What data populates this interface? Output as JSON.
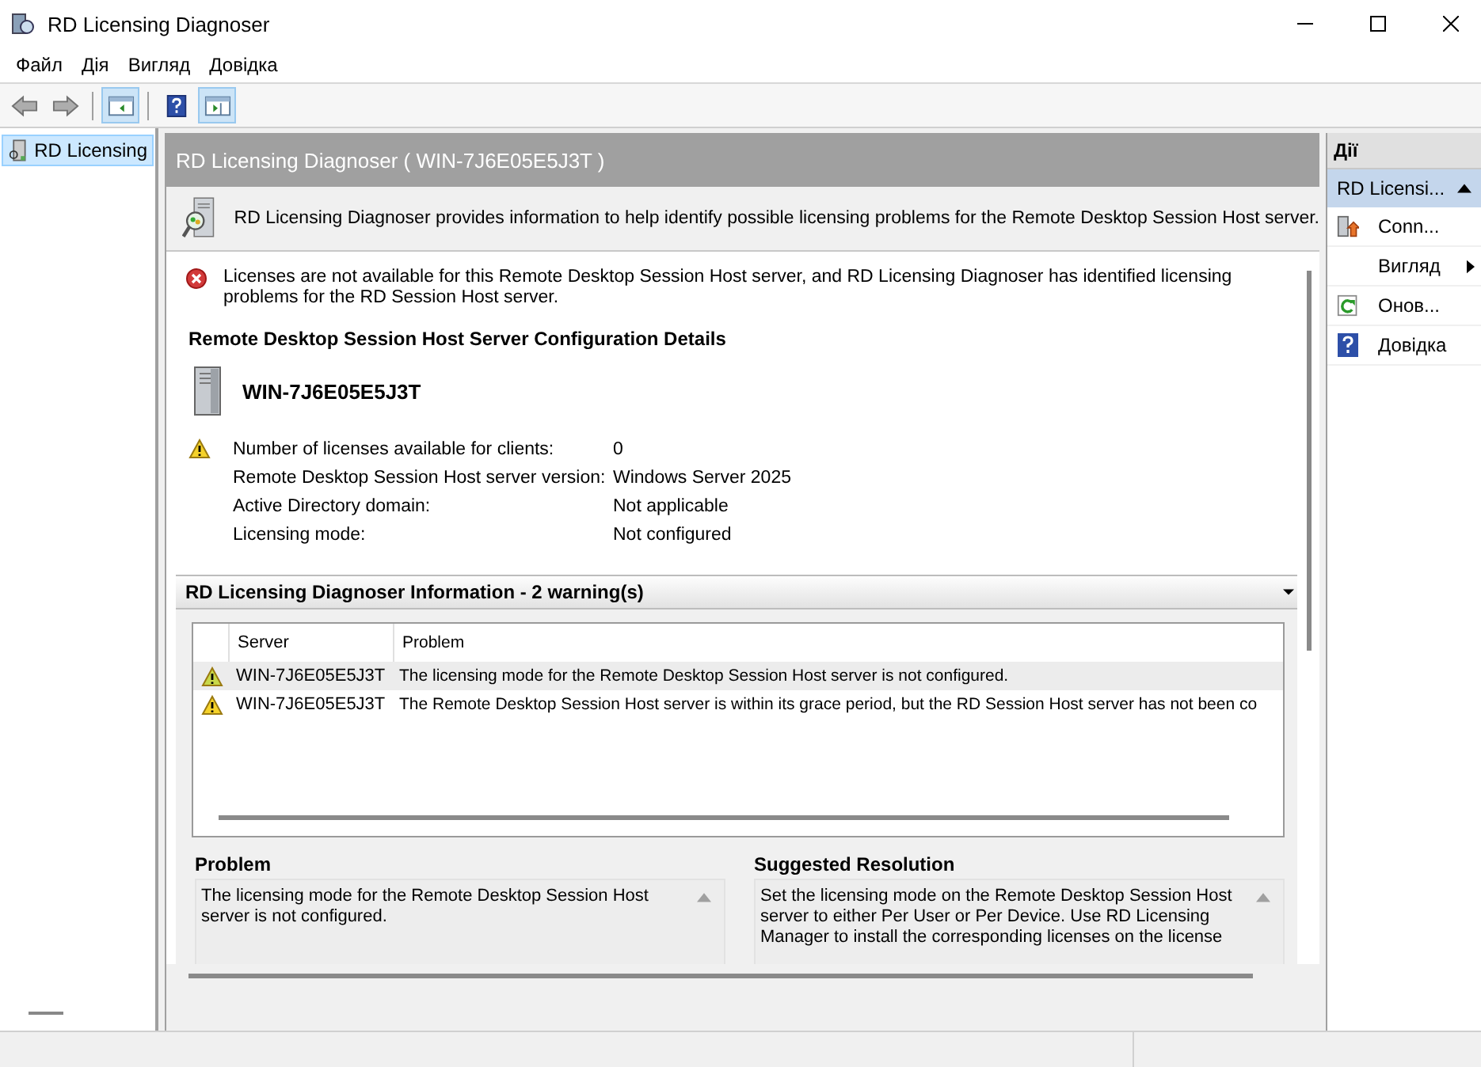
{
  "window": {
    "title": "RD Licensing Diagnoser"
  },
  "menu": [
    "Файл",
    "Дія",
    "Вигляд",
    "Довідка"
  ],
  "toolbar": [
    {
      "kind": "back",
      "disabled": true,
      "pressed": false
    },
    {
      "kind": "forward",
      "disabled": true,
      "pressed": false
    },
    {
      "kind": "tree",
      "disabled": false,
      "pressed": true
    },
    {
      "kind": "help",
      "disabled": false,
      "pressed": false
    },
    {
      "kind": "actions",
      "disabled": false,
      "pressed": true
    }
  ],
  "tree": {
    "items": [
      {
        "label": "RD Licensing",
        "selected": true
      }
    ]
  },
  "center": {
    "title": "RD Licensing Diagnoser ( WIN-7J6E05E5J3T )",
    "description": "RD Licensing Diagnoser provides information to help identify possible licensing problems for the Remote Desktop Session Host server.",
    "error": "Licenses are not available for this Remote Desktop Session Host server, and RD Licensing Diagnoser has identified licensing problems for the RD Session Host server.",
    "details_heading": "Remote Desktop Session Host Server Configuration Details",
    "server_name": "WIN-7J6E05E5J3T",
    "details": [
      {
        "label": "Number of licenses available for clients:",
        "value": "0",
        "warning": true
      },
      {
        "label": "Remote Desktop Session Host server version:",
        "value": "Windows Server 2025",
        "warning": false
      },
      {
        "label": "Active Directory domain:",
        "value": "Not applicable",
        "warning": false
      },
      {
        "label": "Licensing mode:",
        "value": "Not configured",
        "warning": false
      }
    ],
    "info": {
      "title": "RD Licensing Diagnoser Information - 2 warning(s)",
      "expanded": true,
      "columns": [
        "Server",
        "Problem"
      ],
      "rows": [
        {
          "server": "WIN-7J6E05E5J3T",
          "problem": "The licensing mode for the Remote Desktop Session Host server is not configured.",
          "selected": true
        },
        {
          "server": "WIN-7J6E05E5J3T",
          "problem": "The Remote Desktop Session Host server is within its grace period, but the RD Session Host server has not been co",
          "selected": false
        }
      ],
      "problem_heading": "Problem",
      "problem_text": "The licensing mode for the Remote Desktop Session Host server is not configured.",
      "resolution_heading": "Suggested Resolution",
      "resolution_text": "Set the licensing mode on the Remote Desktop Session Host server to either Per User or Per Device. Use RD Licensing Manager to install the corresponding licenses on the license"
    }
  },
  "actions": {
    "title": "Дії",
    "items": [
      {
        "kind": "group",
        "label": "RD Licensi..."
      },
      {
        "kind": "connect",
        "label": "Conn..."
      },
      {
        "kind": "submenu",
        "label": "Вигляд"
      },
      {
        "kind": "refresh",
        "label": "Онов..."
      },
      {
        "kind": "help",
        "label": "Довідка"
      }
    ]
  }
}
